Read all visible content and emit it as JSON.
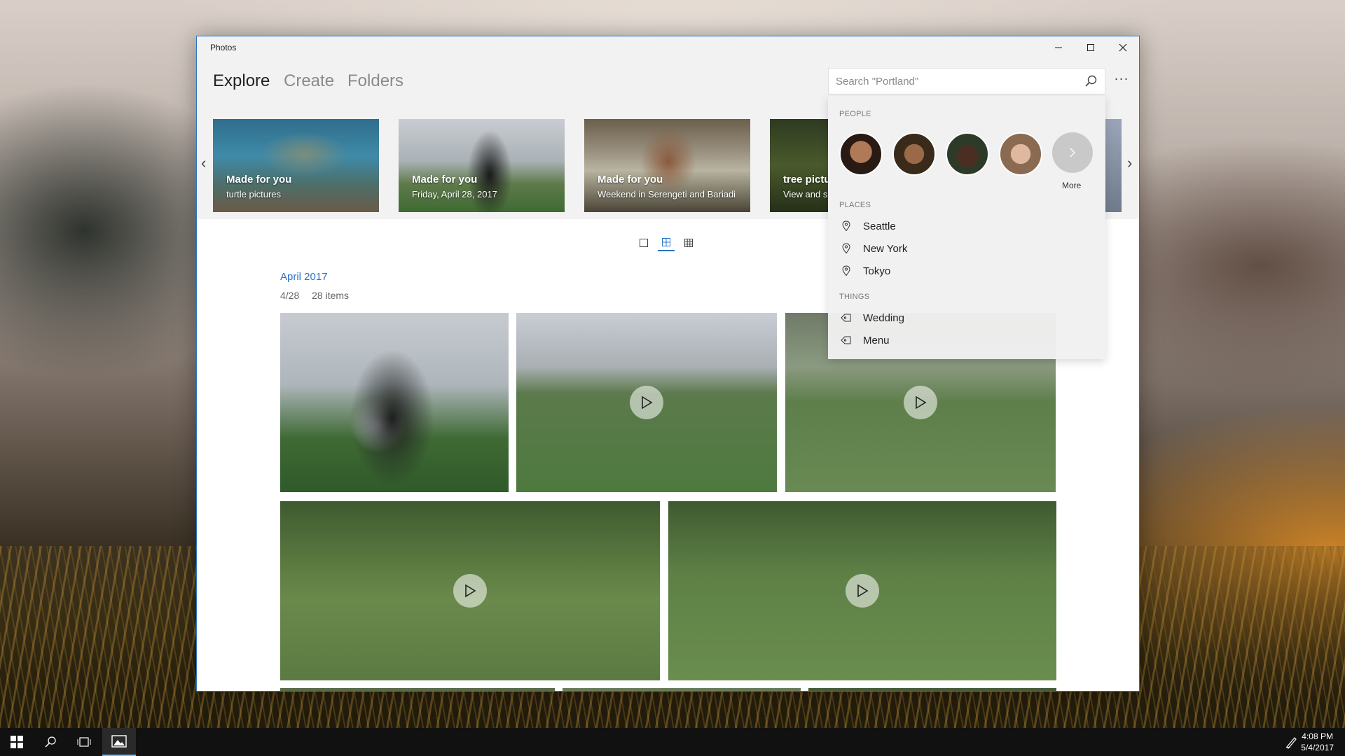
{
  "window": {
    "title": "Photos"
  },
  "nav": {
    "tabs": [
      {
        "label": "Explore",
        "active": true
      },
      {
        "label": "Create"
      },
      {
        "label": "Folders"
      }
    ]
  },
  "search": {
    "placeholder": "Search \"Portland\"",
    "value": ""
  },
  "more_menu_label": "···",
  "carousel": {
    "cards": [
      {
        "title": "Made for you",
        "subtitle": "turtle pictures"
      },
      {
        "title": "Made for you",
        "subtitle": "Friday, April 28, 2017"
      },
      {
        "title": "Made for you",
        "subtitle": "Weekend in Serengeti and Bariadi"
      },
      {
        "title": "tree pictu",
        "subtitle": "View and s"
      }
    ]
  },
  "gallery": {
    "month": "April 2017",
    "date": "4/28",
    "count": "28 items"
  },
  "suggestions": {
    "people_header": "PEOPLE",
    "more_label": "More",
    "places_header": "PLACES",
    "places": [
      "Seattle",
      "New York",
      "Tokyo"
    ],
    "things_header": "THINGS",
    "things": [
      "Wedding",
      "Menu"
    ]
  },
  "taskbar": {
    "time": "4:08 PM",
    "date": "5/4/2017"
  },
  "colors": {
    "accent": "#2b74c5",
    "window_border": "#2b74c5"
  }
}
